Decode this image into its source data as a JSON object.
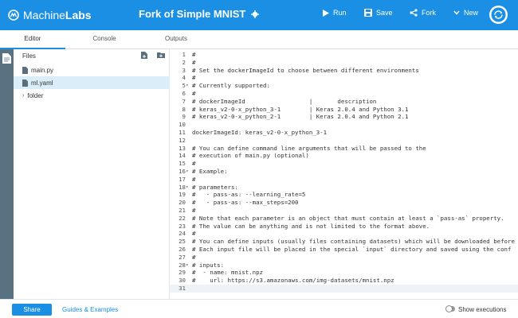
{
  "brand": {
    "name_light": "Machine",
    "name_bold": "Labs"
  },
  "header": {
    "title": "Fork of Simple MNIST",
    "run_label": "Run",
    "save_label": "Save",
    "fork_label": "Fork",
    "new_label": "New"
  },
  "tabs": [
    {
      "label": "Editor",
      "active": true
    },
    {
      "label": "Console",
      "active": false
    },
    {
      "label": "Outputs",
      "active": false
    }
  ],
  "files": {
    "heading": "Files",
    "items": [
      {
        "label": "main.py",
        "type": "file",
        "selected": false
      },
      {
        "label": "ml.yaml",
        "type": "file",
        "selected": true
      },
      {
        "label": "folder",
        "type": "folder",
        "selected": false
      }
    ]
  },
  "editor": {
    "current_line": 31,
    "lines": [
      {
        "n": "1",
        "fold": "",
        "text": "#"
      },
      {
        "n": "2",
        "fold": "",
        "text": "#"
      },
      {
        "n": "3",
        "fold": "",
        "text": "# Set the dockerImageId to choose between different environments"
      },
      {
        "n": "4",
        "fold": "",
        "text": "#"
      },
      {
        "n": "5",
        "fold": "▾",
        "text": "# Currently supported:"
      },
      {
        "n": "6",
        "fold": "",
        "text": "#"
      },
      {
        "n": "7",
        "fold": "",
        "text": "# dockerImageId                  |       description"
      },
      {
        "n": "8",
        "fold": "",
        "text": "# keras_v2-0-x_python_3-1        | Keras 2.0.4 and Python 3.1"
      },
      {
        "n": "9",
        "fold": "",
        "text": "# keras_v2-0-x_python_2-1        | Keras 2.0.4 and Python 2.1"
      },
      {
        "n": "10",
        "fold": "",
        "text": ""
      },
      {
        "n": "11",
        "fold": "",
        "text": "dockerImageId: keras_v2-0-x_python_3-1"
      },
      {
        "n": "12",
        "fold": "",
        "text": ""
      },
      {
        "n": "13",
        "fold": "",
        "text": "# You can define command line arguments that will be passed to the"
      },
      {
        "n": "14",
        "fold": "",
        "text": "# execution of main.py (optional)"
      },
      {
        "n": "15",
        "fold": "",
        "text": "#"
      },
      {
        "n": "16",
        "fold": "▾",
        "text": "# Example:"
      },
      {
        "n": "17",
        "fold": "",
        "text": "#"
      },
      {
        "n": "18",
        "fold": "▾",
        "text": "# parameters:"
      },
      {
        "n": "19",
        "fold": "",
        "text": "#   - pass-as: --learning_rate=5"
      },
      {
        "n": "20",
        "fold": "",
        "text": "#   - pass-as: --max_steps=200"
      },
      {
        "n": "21",
        "fold": "",
        "text": "#"
      },
      {
        "n": "22",
        "fold": "",
        "text": "# Note that each parameter is an object that must contain at least a `pass-as` property."
      },
      {
        "n": "23",
        "fold": "",
        "text": "# The value can be anything and is not limited to the format above."
      },
      {
        "n": "24",
        "fold": "",
        "text": "#"
      },
      {
        "n": "25",
        "fold": "",
        "text": "# You can define inputs (usually files containing datasets) which will be downloaded before"
      },
      {
        "n": "26",
        "fold": "",
        "text": "# Each input file will be placed in the special `input` directory and saved using the conf"
      },
      {
        "n": "27",
        "fold": "",
        "text": "#"
      },
      {
        "n": "28",
        "fold": "▾",
        "text": "# inputs:"
      },
      {
        "n": "29",
        "fold": "",
        "text": "#  - name: mnist.npz"
      },
      {
        "n": "30",
        "fold": "",
        "text": "#    url: https://s3.amazonaws.com/img-datasets/mnist.npz"
      },
      {
        "n": "31",
        "fold": "",
        "text": ""
      }
    ]
  },
  "footer": {
    "share_label": "Share",
    "guides_label": "Guides & Examples",
    "show_exec_label": "Show executions",
    "show_exec_on": false
  },
  "colors": {
    "accent": "#1a8fe3",
    "rail": "#587282",
    "selected": "#d9eef9"
  }
}
